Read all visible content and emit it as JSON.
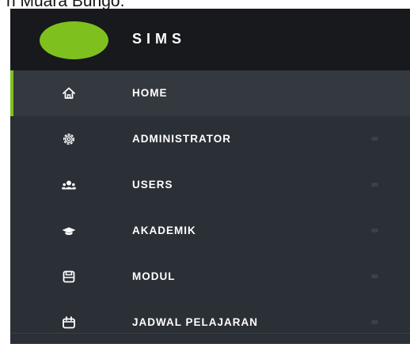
{
  "caption": "n Muara Bungo.",
  "brand": {
    "title": "SIMS",
    "logo_color": "#7ec11e"
  },
  "colors": {
    "sidebar_bg": "#2b2f36",
    "header_bg": "#18191c",
    "active_bg": "#34383f",
    "accent": "#7ec11e",
    "text": "#ffffff"
  },
  "menu": {
    "items": [
      {
        "label": "HOME",
        "icon": "home-icon",
        "active": true,
        "has_submenu": false
      },
      {
        "label": "ADMINISTRATOR",
        "icon": "gear-icon",
        "active": false,
        "has_submenu": true
      },
      {
        "label": "USERS",
        "icon": "users-icon",
        "active": false,
        "has_submenu": true
      },
      {
        "label": "AKADEMIK",
        "icon": "graduation-cap-icon",
        "active": false,
        "has_submenu": true
      },
      {
        "label": "MODUL",
        "icon": "save-icon",
        "active": false,
        "has_submenu": true
      },
      {
        "label": "JADWAL PELAJARAN",
        "icon": "calendar-icon",
        "active": false,
        "has_submenu": true
      }
    ]
  }
}
